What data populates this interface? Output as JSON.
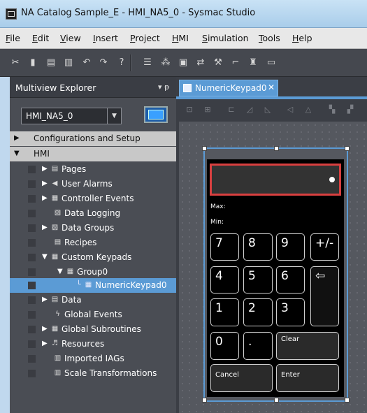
{
  "window": {
    "title": "NA Catalog Sample_E - HMI_NA5_0 - Sysmac Studio",
    "icon": "monitor-app-icon"
  },
  "menu": [
    "File",
    "Edit",
    "View",
    "Insert",
    "Project",
    "HMI",
    "Simulation",
    "Tools",
    "Help"
  ],
  "menu_underline": [
    "F",
    "E",
    "V",
    "I",
    "P",
    "H",
    "S",
    "T",
    "H"
  ],
  "toolbar": {
    "icons": [
      "cut-icon",
      "copy-icon",
      "paste-icon",
      "delete-icon",
      "undo-icon",
      "redo-icon",
      "help-icon",
      "tree-icon",
      "compare-icon",
      "build-icon",
      "transfer-icon",
      "simulate-icon",
      "tool-icon",
      "search-icon",
      "window-icon"
    ]
  },
  "explorer": {
    "title": "Multiview Explorer",
    "pin": "▾ ᵽ",
    "device": "HMI_NA5_0",
    "items": [
      {
        "label": "Configurations and Setup",
        "section": true,
        "arrow": "▶",
        "level": 0
      },
      {
        "label": "HMI",
        "section": true,
        "arrow": "▼",
        "level": 0
      },
      {
        "label": "Pages",
        "arrow": "▶",
        "icon": "pages-icon",
        "level": 1
      },
      {
        "label": "User Alarms",
        "arrow": "▶",
        "icon": "alarm-icon",
        "level": 1
      },
      {
        "label": "Controller Events",
        "arrow": "▶",
        "icon": "events-icon",
        "level": 1
      },
      {
        "label": "Data Logging",
        "arrow": "",
        "icon": "data-logging-icon",
        "level": 1
      },
      {
        "label": "Data Groups",
        "arrow": "▶",
        "icon": "data-groups-icon",
        "level": 1
      },
      {
        "label": "Recipes",
        "arrow": "",
        "icon": "recipes-icon",
        "level": 1
      },
      {
        "label": "Custom Keypads",
        "arrow": "▼",
        "icon": "keypads-icon",
        "level": 1
      },
      {
        "label": "Group0",
        "arrow": "▼",
        "icon": "group-icon",
        "level": 2
      },
      {
        "label": "NumericKeypad0",
        "arrow": "",
        "icon": "keypad-icon",
        "level": 3,
        "selected": true
      },
      {
        "label": "Data",
        "arrow": "▶",
        "icon": "data-icon",
        "level": 1
      },
      {
        "label": "Global Events",
        "arrow": "",
        "icon": "global-events-icon",
        "level": 1
      },
      {
        "label": "Global Subroutines",
        "arrow": "▶",
        "icon": "subroutines-icon",
        "level": 1
      },
      {
        "label": "Resources",
        "arrow": "▶",
        "icon": "resources-icon",
        "level": 1
      },
      {
        "label": "Imported IAGs",
        "arrow": "",
        "icon": "iags-icon",
        "level": 1
      },
      {
        "label": "Scale Transformations",
        "arrow": "",
        "icon": "scale-icon",
        "level": 1
      }
    ]
  },
  "editor": {
    "tab": "NumericKeypad0",
    "keypad": {
      "max_label": "Max:",
      "min_label": "Min:",
      "keys": [
        "7",
        "8",
        "9",
        "+/-",
        "4",
        "5",
        "6",
        "⇦",
        "1",
        "2",
        "3",
        "0",
        ".",
        "Clear",
        "Cancel",
        "Enter"
      ]
    }
  }
}
